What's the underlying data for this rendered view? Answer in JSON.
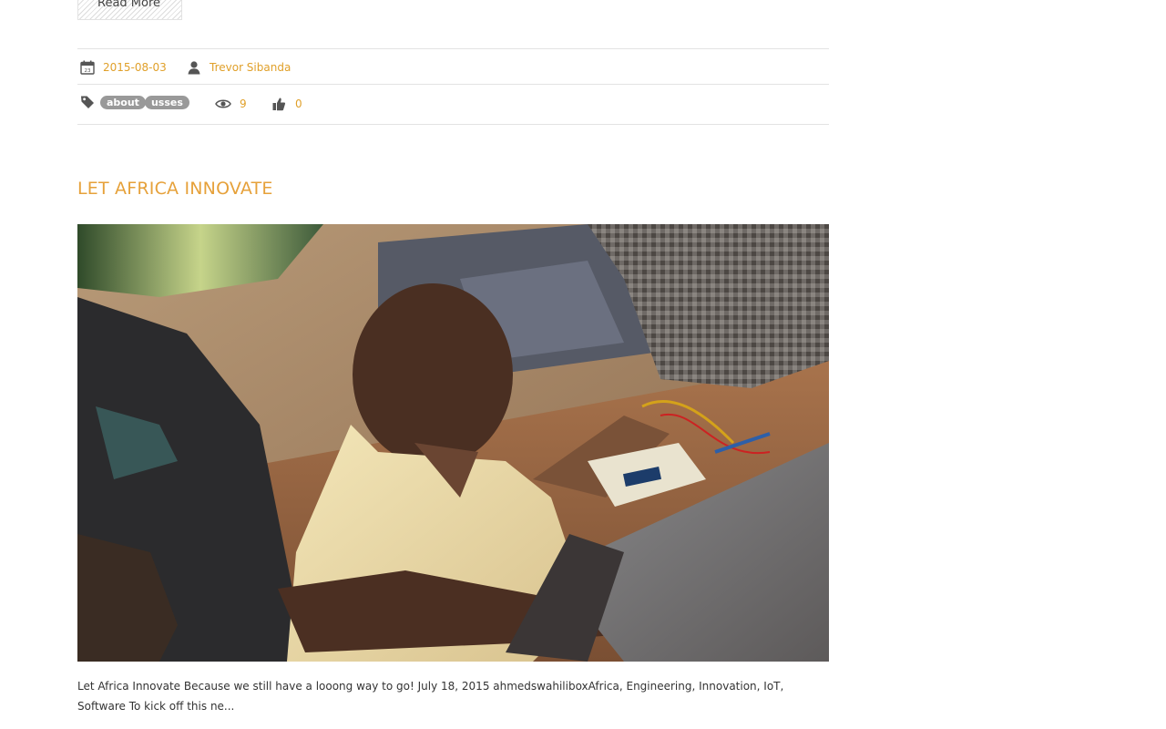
{
  "previous_post": {
    "read_more_label": "Read More",
    "date": "2015-08-03",
    "author": "Trevor Sibanda",
    "tags": [
      "about",
      "usses"
    ],
    "views": "9",
    "likes": "0"
  },
  "post": {
    "title": "LET AFRICA INNOVATE",
    "excerpt": "Let Africa Innovate Because we still have a looong way to go! July 18, 2015 ahmedswahiliboxAfrica, Engineering, Innovation, IoT, Software To kick off this ne..."
  },
  "icons": {
    "date": "calendar-icon",
    "author": "user-icon",
    "tags": "tag-icon",
    "views": "eye-icon",
    "likes": "thumbs-up-icon"
  },
  "colors": {
    "accent": "#e6a13a",
    "link": "#e0a02a",
    "tag_bg": "#999999",
    "icon": "#555555"
  }
}
